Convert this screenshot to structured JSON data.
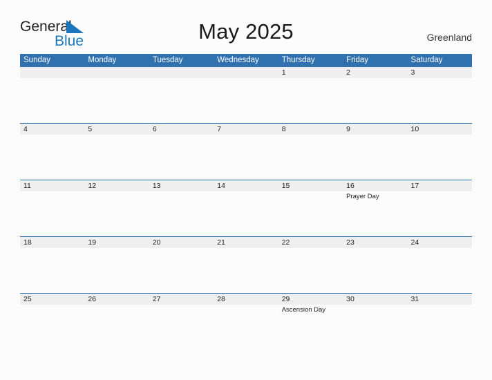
{
  "brand": {
    "name_part1": "General",
    "name_part2": "Blue",
    "flag_icon": "triangle-flag-icon",
    "color_primary": "#1b76bc",
    "color_dark": "#222226"
  },
  "header": {
    "title": "May 2025",
    "subtitle": "Greenland"
  },
  "theme": {
    "header_blue": "#3071b0",
    "row_band_gray": "#efefef",
    "row_rule_blue": "#2f71b5",
    "page_background": "#fcfcfc"
  },
  "calendar": {
    "weekday_headers": [
      "Sunday",
      "Monday",
      "Tuesday",
      "Wednesday",
      "Thursday",
      "Friday",
      "Saturday"
    ],
    "weeks": [
      [
        {
          "date": "",
          "events": []
        },
        {
          "date": "",
          "events": []
        },
        {
          "date": "",
          "events": []
        },
        {
          "date": "",
          "events": []
        },
        {
          "date": "1",
          "events": []
        },
        {
          "date": "2",
          "events": []
        },
        {
          "date": "3",
          "events": []
        }
      ],
      [
        {
          "date": "4",
          "events": []
        },
        {
          "date": "5",
          "events": []
        },
        {
          "date": "6",
          "events": []
        },
        {
          "date": "7",
          "events": []
        },
        {
          "date": "8",
          "events": []
        },
        {
          "date": "9",
          "events": []
        },
        {
          "date": "10",
          "events": []
        }
      ],
      [
        {
          "date": "11",
          "events": []
        },
        {
          "date": "12",
          "events": []
        },
        {
          "date": "13",
          "events": []
        },
        {
          "date": "14",
          "events": []
        },
        {
          "date": "15",
          "events": []
        },
        {
          "date": "16",
          "events": [
            "Prayer Day"
          ]
        },
        {
          "date": "17",
          "events": []
        }
      ],
      [
        {
          "date": "18",
          "events": []
        },
        {
          "date": "19",
          "events": []
        },
        {
          "date": "20",
          "events": []
        },
        {
          "date": "21",
          "events": []
        },
        {
          "date": "22",
          "events": []
        },
        {
          "date": "23",
          "events": []
        },
        {
          "date": "24",
          "events": []
        }
      ],
      [
        {
          "date": "25",
          "events": []
        },
        {
          "date": "26",
          "events": []
        },
        {
          "date": "27",
          "events": []
        },
        {
          "date": "28",
          "events": []
        },
        {
          "date": "29",
          "events": [
            "Ascension Day"
          ]
        },
        {
          "date": "30",
          "events": []
        },
        {
          "date": "31",
          "events": []
        }
      ]
    ]
  }
}
